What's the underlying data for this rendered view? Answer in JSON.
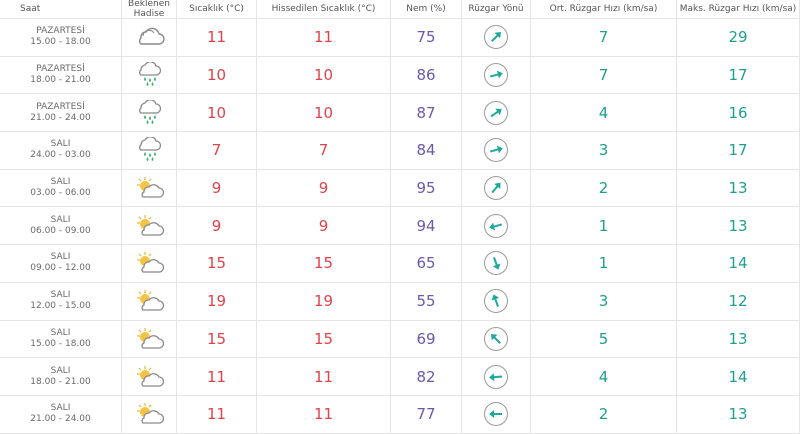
{
  "headers": {
    "time": "Saat",
    "event": "Beklenen\nHadise",
    "temp": "Sıcaklık (°C)",
    "feels": "Hissedilen Sıcaklık (°C)",
    "humidity": "Nem (%)",
    "wind_dir": "Rüzgar Yönü",
    "avg_wind": "Ort. Rüzgar Hızı (km/sa)",
    "max_wind": "Maks. Rüzgar Hızı (km/sa)"
  },
  "colors": {
    "temp": "#e0424a",
    "humidity": "#6b5aa8",
    "wind": "#1f9f8f",
    "arrow": "#1fa99a"
  },
  "rows": [
    {
      "day": "PAZARTESİ",
      "range": "15.00 - 18.00",
      "icon": "cloudy-icon",
      "temp": "11",
      "feels": "11",
      "humidity": "75",
      "wind_deg": 45,
      "avg": "7",
      "max": "29"
    },
    {
      "day": "PAZARTESİ",
      "range": "18.00 - 21.00",
      "icon": "rain-icon",
      "temp": "10",
      "feels": "10",
      "humidity": "86",
      "wind_deg": 75,
      "avg": "7",
      "max": "17"
    },
    {
      "day": "PAZARTESİ",
      "range": "21.00 - 24.00",
      "icon": "rain-icon",
      "temp": "10",
      "feels": "10",
      "humidity": "87",
      "wind_deg": 55,
      "avg": "4",
      "max": "16"
    },
    {
      "day": "SALI",
      "range": "24.00 - 03.00",
      "icon": "rain-icon",
      "temp": "7",
      "feels": "7",
      "humidity": "84",
      "wind_deg": 75,
      "avg": "3",
      "max": "17"
    },
    {
      "day": "SALI",
      "range": "03.00 - 06.00",
      "icon": "partly-cloudy-icon",
      "temp": "9",
      "feels": "9",
      "humidity": "95",
      "wind_deg": 40,
      "avg": "2",
      "max": "13"
    },
    {
      "day": "SALI",
      "range": "06.00 - 09.00",
      "icon": "partly-cloudy-icon",
      "temp": "9",
      "feels": "9",
      "humidity": "94",
      "wind_deg": 255,
      "avg": "1",
      "max": "13"
    },
    {
      "day": "SALI",
      "range": "09.00 - 12.00",
      "icon": "partly-cloudy-icon",
      "temp": "15",
      "feels": "15",
      "humidity": "65",
      "wind_deg": 160,
      "avg": "1",
      "max": "14"
    },
    {
      "day": "SALI",
      "range": "12.00 - 15.00",
      "icon": "partly-cloudy-icon",
      "temp": "19",
      "feels": "19",
      "humidity": "55",
      "wind_deg": 340,
      "avg": "3",
      "max": "12"
    },
    {
      "day": "SALI",
      "range": "15.00 - 18.00",
      "icon": "partly-cloudy-icon",
      "temp": "15",
      "feels": "15",
      "humidity": "69",
      "wind_deg": 315,
      "avg": "5",
      "max": "13"
    },
    {
      "day": "SALI",
      "range": "18.00 - 21.00",
      "icon": "partly-cloudy-icon",
      "temp": "11",
      "feels": "11",
      "humidity": "82",
      "wind_deg": 265,
      "avg": "4",
      "max": "14"
    },
    {
      "day": "SALI",
      "range": "21.00 - 24.00",
      "icon": "partly-cloudy-icon",
      "temp": "11",
      "feels": "11",
      "humidity": "77",
      "wind_deg": 270,
      "avg": "2",
      "max": "13"
    }
  ]
}
